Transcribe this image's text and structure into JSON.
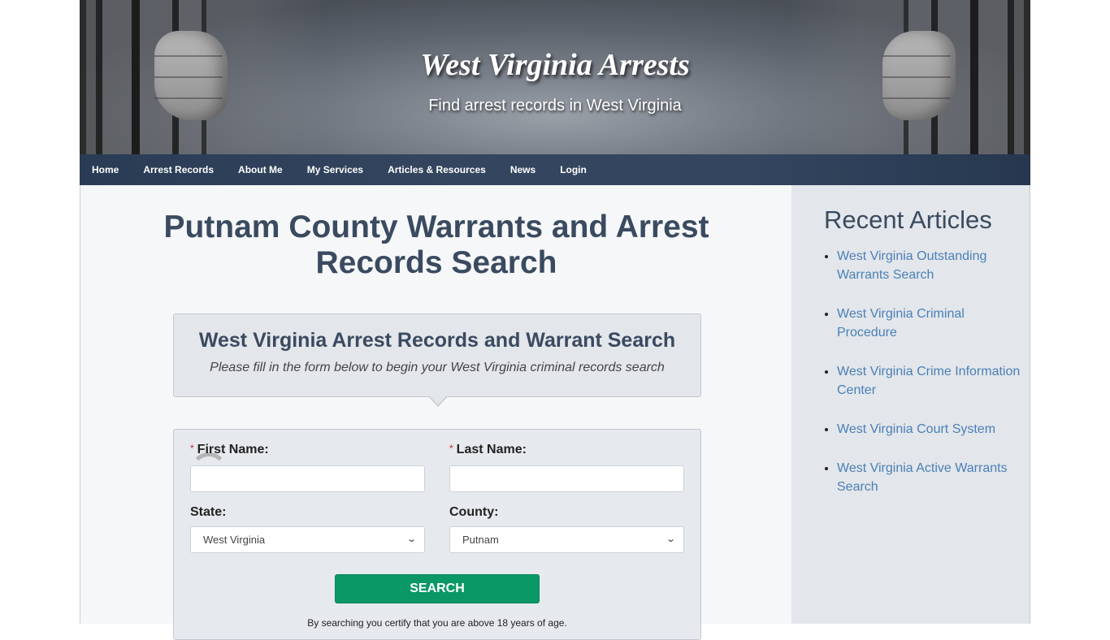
{
  "header": {
    "site_title": "West Virginia Arrests",
    "tagline": "Find arrest records in West Virginia"
  },
  "nav": {
    "items": [
      {
        "label": "Home"
      },
      {
        "label": "Arrest Records"
      },
      {
        "label": "About Me"
      },
      {
        "label": "My Services"
      },
      {
        "label": "Articles & Resources"
      },
      {
        "label": "News"
      },
      {
        "label": "Login"
      }
    ]
  },
  "main": {
    "page_title": "Putnam County Warrants and Arrest Records Search",
    "intro": {
      "heading": "West Virginia Arrest Records and Warrant Search",
      "subheading": "Please fill in the form below to begin your West Virginia criminal records search"
    },
    "form": {
      "required_marker": "*",
      "first_name_label": "First Name:",
      "first_name_value": "",
      "last_name_label": "Last Name:",
      "last_name_value": "",
      "state_label": "State:",
      "state_value": "West Virginia",
      "county_label": "County:",
      "county_value": "Putnam",
      "search_button": "SEARCH",
      "disclaimer": "By searching you certify that you are above 18 years of age."
    }
  },
  "sidebar": {
    "title": "Recent Articles",
    "articles": [
      {
        "label": "West Virginia Outstanding Warrants Search"
      },
      {
        "label": "West Virginia Criminal Procedure"
      },
      {
        "label": "West Virginia Crime Information Center"
      },
      {
        "label": "West Virginia Court System"
      },
      {
        "label": "West Virginia Active Warrants Search"
      }
    ]
  },
  "colors": {
    "nav_bg": "#34465f",
    "heading_text": "#3a4a60",
    "link": "#4a80b8",
    "search_button": "#0a9866",
    "required": "#d0202a"
  }
}
